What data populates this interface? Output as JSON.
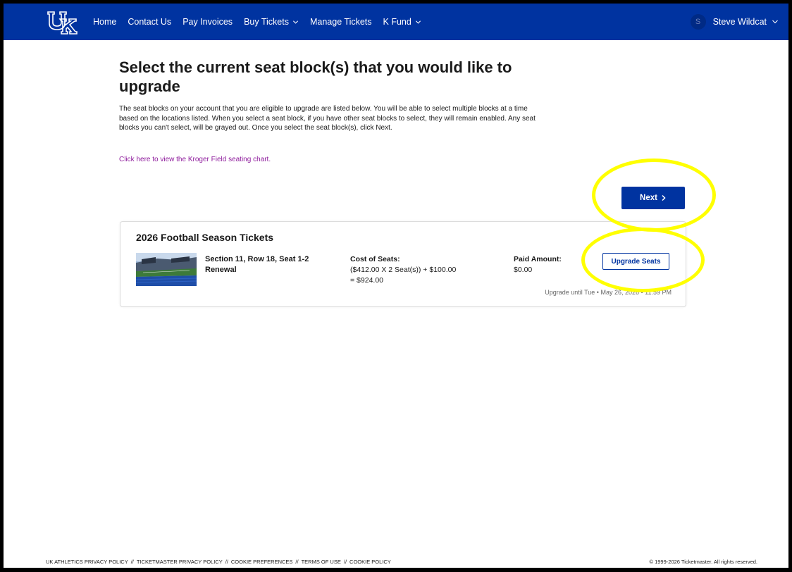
{
  "nav": {
    "items": [
      {
        "label": "Home",
        "dropdown": false
      },
      {
        "label": "Contact Us",
        "dropdown": false
      },
      {
        "label": "Pay Invoices",
        "dropdown": false
      },
      {
        "label": "Buy Tickets",
        "dropdown": true
      },
      {
        "label": "Manage Tickets",
        "dropdown": false
      },
      {
        "label": "K Fund",
        "dropdown": true
      }
    ],
    "user": {
      "initial": "S",
      "name": "Steve Wildcat"
    }
  },
  "main": {
    "title": "Select the current seat block(s) that you would like to upgrade",
    "intro": "The seat blocks on your account that you are eligible to upgrade are listed below. You will be able to select multiple blocks at a time based on the locations listed. When you select a seat block, if you have other seat blocks to select, they will remain enabled. Any seat blocks you can't select, will be grayed out. Once you select the seat block(s), click Next.",
    "chart_link": "Click here to view the Kroger Field seating chart.",
    "next_label": "Next"
  },
  "card": {
    "title": "2026 Football Season Tickets",
    "seat_location": "Section 11, Row 18, Seat 1-2",
    "seat_status": "Renewal",
    "cost_label": "Cost of Seats:",
    "cost_line1": "($412.00 X 2 Seat(s)) + $100.00",
    "cost_line2": "= $924.00",
    "paid_label": "Paid Amount:",
    "paid_value": "$0.00",
    "upgrade_label": "Upgrade Seats",
    "deadline": "Upgrade until Tue • May 26, 2026 • 11:59 PM"
  },
  "footer": {
    "links": [
      "UK ATHLETICS PRIVACY POLICY",
      "TICKETMASTER PRIVACY POLICY",
      "COOKIE PREFERENCES",
      "TERMS OF USE",
      "COOKIE POLICY"
    ],
    "separator": "//",
    "copyright": "© 1999-2026 Ticketmaster. All rights reserved."
  },
  "colors": {
    "brand_blue": "#0033a0",
    "link_purple": "#8e1b9c",
    "highlight_yellow": "#ffff00"
  },
  "icons": {
    "logo": "uk-logo",
    "dropdown": "chevron-down-icon",
    "next": "chevron-right-icon"
  }
}
